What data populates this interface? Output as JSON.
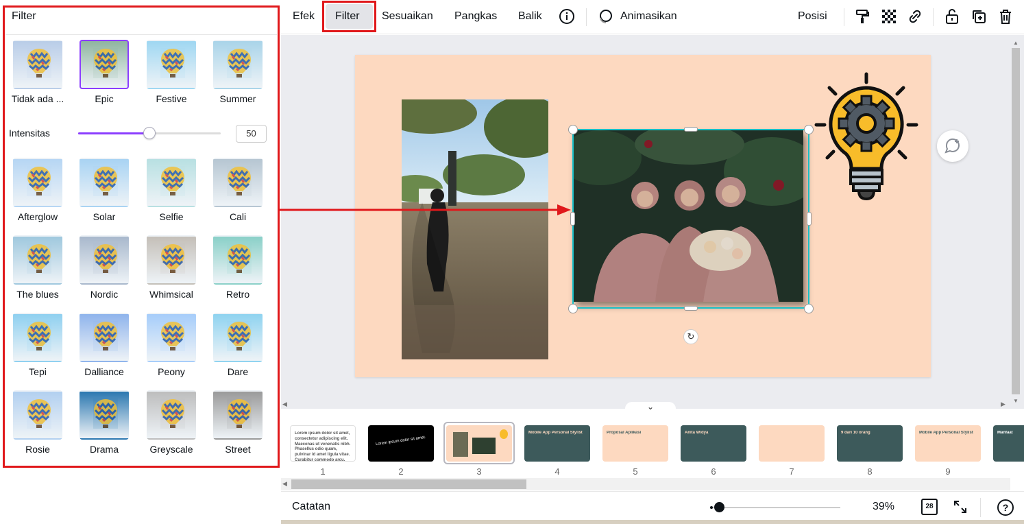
{
  "panel": {
    "title": "Filter",
    "intensity_label": "Intensitas",
    "intensity_value": "50",
    "intensity_fraction": 0.5,
    "filters": [
      {
        "label": "Tidak ada ...",
        "bg": "#b9cde8",
        "selected": false
      },
      {
        "label": "Epic",
        "bg": "#8fb5a0",
        "selected": true
      },
      {
        "label": "Festive",
        "bg": "#9fd7f2",
        "selected": false
      },
      {
        "label": "Summer",
        "bg": "#a9d4e9",
        "selected": false
      },
      {
        "label": "Afterglow",
        "bg": "#b6d6f4",
        "selected": false
      },
      {
        "label": "Solar",
        "bg": "#a8d3f3",
        "selected": false
      },
      {
        "label": "Selfie",
        "bg": "#b8e0e2",
        "selected": false
      },
      {
        "label": "Cali",
        "bg": "#b6c6d2",
        "selected": false
      },
      {
        "label": "The blues",
        "bg": "#9fc8de",
        "selected": false
      },
      {
        "label": "Nordic",
        "bg": "#a8b8cc",
        "selected": false
      },
      {
        "label": "Whimsical",
        "bg": "#c4bfb8",
        "selected": false
      },
      {
        "label": "Retro",
        "bg": "#8ad0c8",
        "selected": false
      },
      {
        "label": "Tepi",
        "bg": "#8fd0f0",
        "selected": false
      },
      {
        "label": "Dalliance",
        "bg": "#8fb4ec",
        "selected": false
      },
      {
        "label": "Peony",
        "bg": "#a6cdfa",
        "selected": false
      },
      {
        "label": "Dare",
        "bg": "#8fd3f0",
        "selected": false
      },
      {
        "label": "Rosie",
        "bg": "#b2d0f0",
        "selected": false
      },
      {
        "label": "Drama",
        "bg": "#2b77b0",
        "selected": false
      },
      {
        "label": "Greyscale",
        "bg": "#bdbdbd",
        "selected": false
      },
      {
        "label": "Street",
        "bg": "#9a9a9a",
        "selected": false
      }
    ]
  },
  "toolbar": {
    "efek": "Efek",
    "filter": "Filter",
    "sesuaikan": "Sesuaikan",
    "pangkas": "Pangkas",
    "balik": "Balik",
    "animasikan": "Animasikan",
    "posisi": "Posisi"
  },
  "thumbnails": [
    {
      "num": "1",
      "bg": "#ffffff",
      "text": "Lorem ipsum dolor sit amet, consectetur adipiscing elit. Maecenas ut venenatis nibh. Phasellus odio quam, pulvinar id amet ligula vitae. Curabitur commodo arcu.",
      "text_color": "#555555"
    },
    {
      "num": "2",
      "bg": "#000000",
      "text": "Lorem ipsum dolor sit amet.",
      "text_color": "#ffffff"
    },
    {
      "num": "3",
      "bg": "#fdd9c0",
      "text": "",
      "text_color": "#333333"
    },
    {
      "num": "4",
      "bg": "#3d5a5b",
      "text": "Mobile App Personal Stylist",
      "text_color": "#fdd9c0"
    },
    {
      "num": "5",
      "bg": "#fdd9c0",
      "text": "Proposal Aplikasi",
      "text_color": "#3d5a5b"
    },
    {
      "num": "6",
      "bg": "#3d5a5b",
      "text": "Anita Widya",
      "text_color": "#fdd9c0"
    },
    {
      "num": "7",
      "bg": "#fdd9c0",
      "text": "",
      "text_color": "#3d5a5b"
    },
    {
      "num": "8",
      "bg": "#3d5a5b",
      "text": "9 dari 10 orang",
      "text_color": "#fdd9c0"
    },
    {
      "num": "9",
      "bg": "#fdd9c0",
      "text": "Mobile App Personal Stylist",
      "text_color": "#3d5a5b"
    },
    {
      "num": "",
      "bg": "#3d5a5b",
      "text": "Manfaat",
      "text_color": "#ffffff"
    }
  ],
  "bottom": {
    "notes": "Catatan",
    "zoom": "39%",
    "zoom_fraction": 0.05,
    "pages": "28"
  },
  "colors": {
    "accent": "#8b3dff",
    "highlight": "#e0181b",
    "selection": "#18bfc7",
    "slide_bg": "#fdd9c0"
  }
}
